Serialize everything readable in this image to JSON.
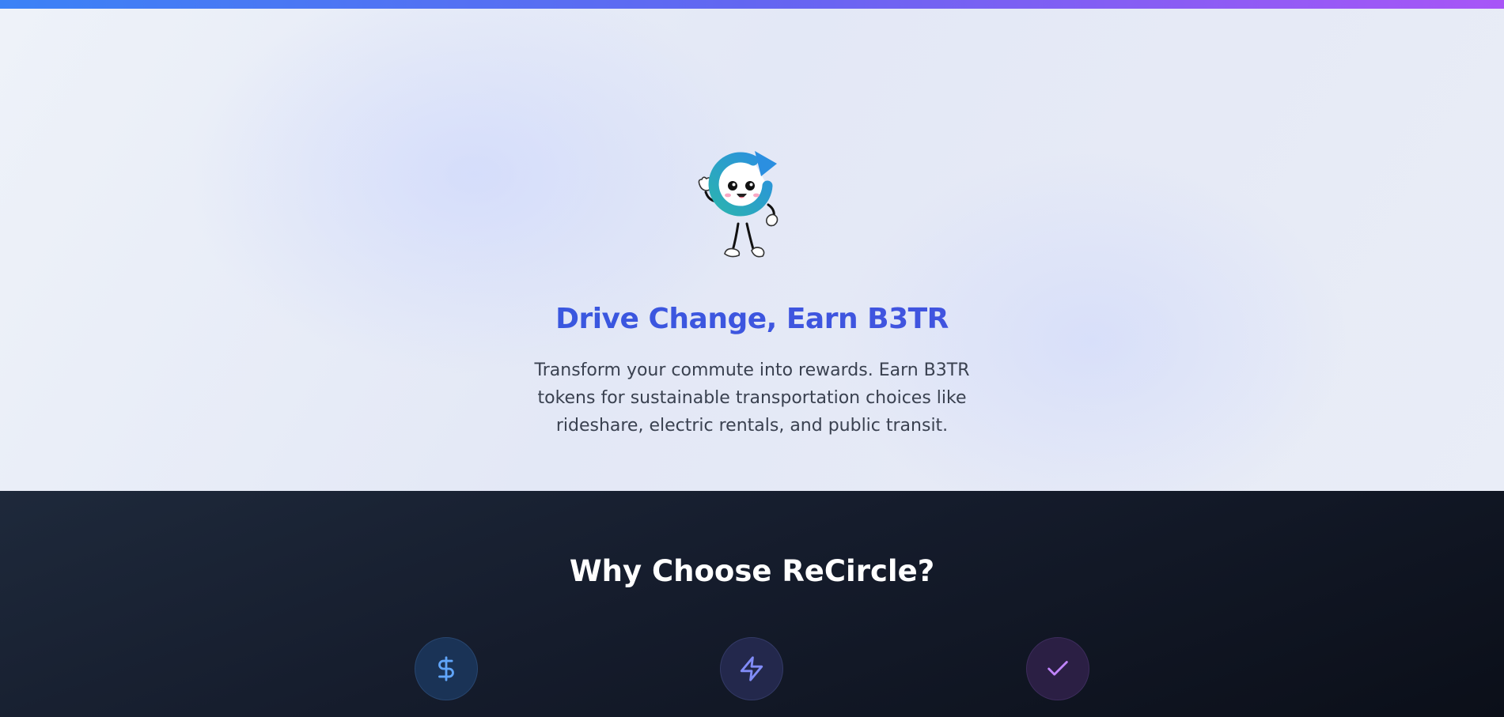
{
  "hero": {
    "title": "Drive Change, Earn B3TR",
    "subtitle": "Transform your commute into rewards. Earn B3TR tokens for sustainable transportation choices like rideshare, electric rentals, and public transit.",
    "mascot_icon": "recircle-mascot-icon"
  },
  "features": {
    "title": "Why Choose ReCircle?",
    "icons": [
      {
        "name": "dollar-icon",
        "color": "#60a5fa"
      },
      {
        "name": "lightning-icon",
        "color": "#818cf8"
      },
      {
        "name": "check-icon",
        "color": "#c084fc"
      }
    ]
  },
  "colors": {
    "accent_gradient_start": "#3b82f6",
    "accent_gradient_end": "#a855f7",
    "hero_title": "#3b5bdb",
    "dark_section": "#111827"
  }
}
